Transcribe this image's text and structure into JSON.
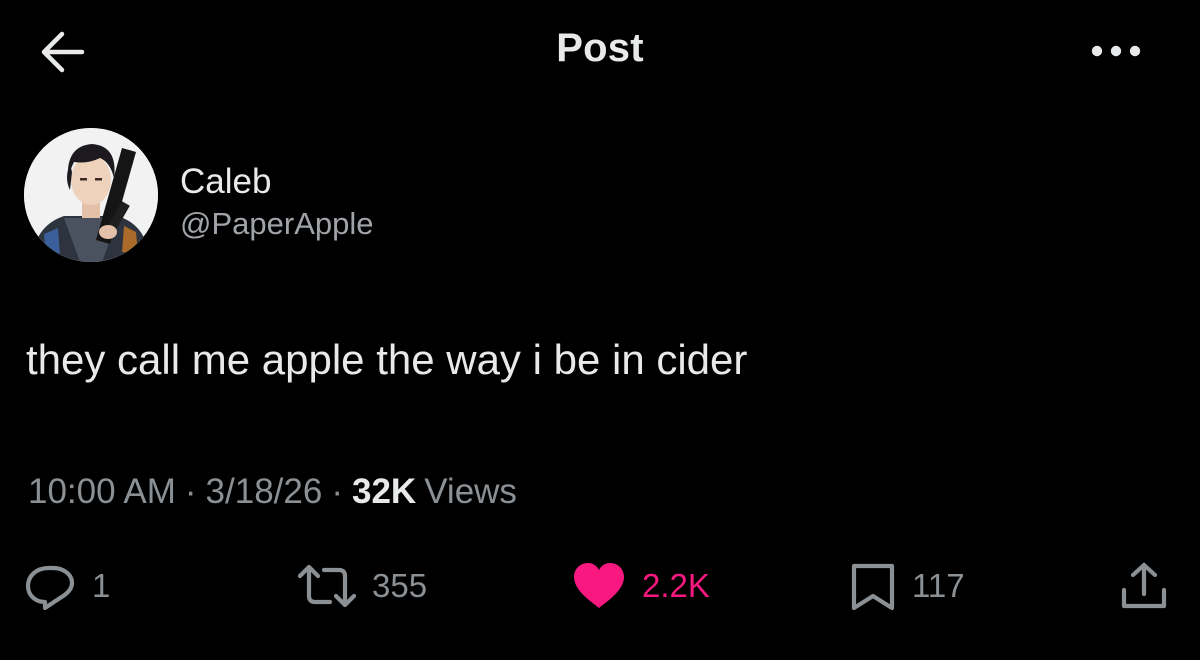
{
  "header": {
    "title": "Post",
    "back_icon": "arrow-left-icon",
    "more_icon": "more-horizontal-icon"
  },
  "author": {
    "display_name": "Caleb",
    "handle": "@PaperApple",
    "avatar_icon": "avatar-image"
  },
  "post": {
    "text": "they call me apple the way i be in cider"
  },
  "meta": {
    "time": "10:00 AM",
    "separator": "·",
    "date": "3/18/26",
    "views_count": "32K",
    "views_label": "Views"
  },
  "actions": {
    "reply_count": "1",
    "retweet_count": "355",
    "like_count": "2.2K",
    "bookmark_count": "117"
  },
  "colors": {
    "background": "#000000",
    "primary_text": "#e7e9ea",
    "secondary_text": "#8b9095",
    "like_pink": "#f91880"
  }
}
